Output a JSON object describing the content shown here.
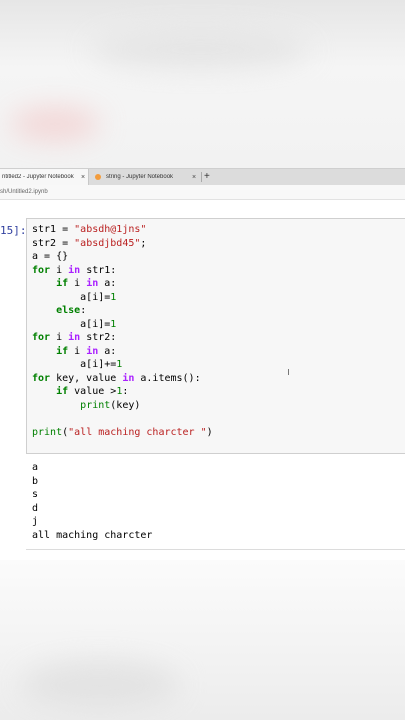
{
  "browser": {
    "tabs": [
      {
        "title": "ntitled2 - Jupyter Notebook",
        "close": "×",
        "active": true
      },
      {
        "title": "string - Jupyter Notebook",
        "close": "×",
        "active": false
      }
    ],
    "new_tab": "+",
    "address": "sh/Untitled2.ipynb"
  },
  "notebook": {
    "cell": {
      "prompt": "15]:",
      "code": [
        "str1 = \"absdh@1jns\"",
        "str2 = \"absdjbd45\";",
        "a = {}",
        "for i in str1:",
        "    if i in a:",
        "        a[i]=1",
        "    else:",
        "        a[i]=1",
        "for i in str2:",
        "    if i in a:",
        "        a[i]+=1",
        "for key, value in a.items():",
        "    if value >1:",
        "        print(key)",
        "",
        "print(\"all maching charcter \")"
      ],
      "output": [
        "a",
        "b",
        "s",
        "d",
        "j",
        "all maching charcter"
      ]
    }
  }
}
